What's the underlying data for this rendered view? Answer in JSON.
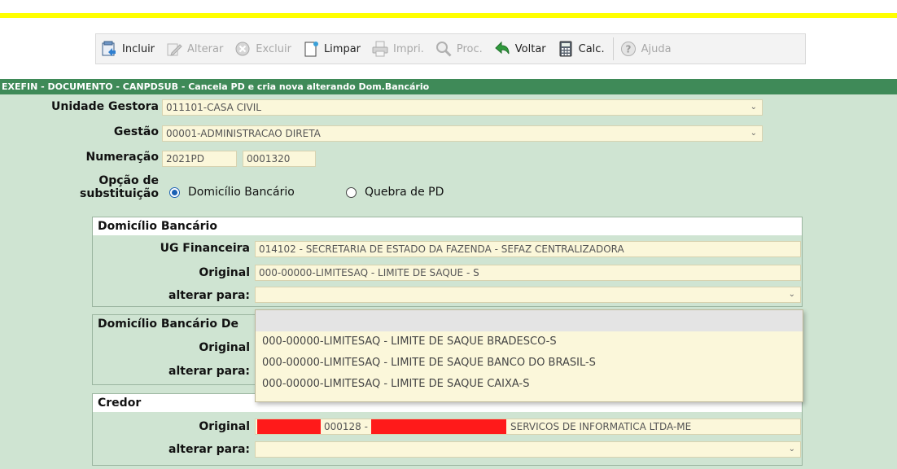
{
  "toolbar": {
    "buttons": [
      {
        "label": "Incluir",
        "icon": "add-document-icon",
        "enabled": true
      },
      {
        "label": "Alterar",
        "icon": "edit-icon",
        "enabled": false
      },
      {
        "label": "Excluir",
        "icon": "delete-icon",
        "enabled": false
      },
      {
        "label": "Limpar",
        "icon": "clear-document-icon",
        "enabled": true
      },
      {
        "label": "Impri.",
        "icon": "printer-icon",
        "enabled": false
      },
      {
        "label": "Proc.",
        "icon": "magnifier-icon",
        "enabled": false
      },
      {
        "label": "Voltar",
        "icon": "back-arrow-icon",
        "enabled": true
      },
      {
        "label": "Calc.",
        "icon": "calculator-icon",
        "enabled": true
      },
      {
        "label": "Ajuda",
        "icon": "help-icon",
        "enabled": false
      }
    ]
  },
  "title": "EXEFIN - DOCUMENTO - CANPDSUB - Cancela PD e cria nova alterando Dom.Bancário",
  "form": {
    "unidade_label": "Unidade Gestora",
    "unidade_value": "011101-CASA CIVIL",
    "gestao_label": "Gestão",
    "gestao_value": "00001-ADMINISTRACAO DIRETA",
    "numeracao_label": "Numeração",
    "numeracao_ano": "2021PD",
    "numeracao_num": "0001320",
    "opcao_label_1": "Opção de",
    "opcao_label_2": "substituição",
    "option_domicilio": "Domicílio Bancário",
    "option_quebra": "Quebra de PD",
    "selected_option": "Domicílio Bancário"
  },
  "panel_domicilio": {
    "title": "Domicílio Bancário",
    "ug_label": "UG Financeira",
    "ug_value": "014102 - SECRETARIA DE ESTADO DA FAZENDA - SEFAZ  CENTRALIZADORA",
    "original_label": "Original",
    "original_value": "000-00000-LIMITESAQ - LIMITE DE SAQUE - S",
    "alterar_label": "alterar para:",
    "alterar_value": ""
  },
  "panel_domicilio_dev": {
    "title": "Domicílio Bancário De",
    "original_label": "Original",
    "alterar_label": "alterar para:"
  },
  "panel_credor": {
    "title": "Credor",
    "original_label": "Original",
    "original_value_part1": "000128 -",
    "original_value_part2": "SERVICOS DE INFORMATICA LTDA-ME",
    "alterar_label": "alterar para:",
    "alterar_value": ""
  },
  "dropdown": {
    "options": [
      "",
      "000-00000-LIMITESAQ - LIMITE DE SAQUE BRADESCO-S",
      "000-00000-LIMITESAQ - LIMITE DE SAQUE BANCO DO BRASIL-S",
      "000-00000-LIMITESAQ - LIMITE DE SAQUE CAIXA-S"
    ]
  },
  "colors": {
    "title_bar": "#3f8a58",
    "content_bg": "#cfe4d2",
    "field_bg": "#fbf7da",
    "accent_yellow": "#ffff00",
    "redaction": "#ff1a1a"
  }
}
